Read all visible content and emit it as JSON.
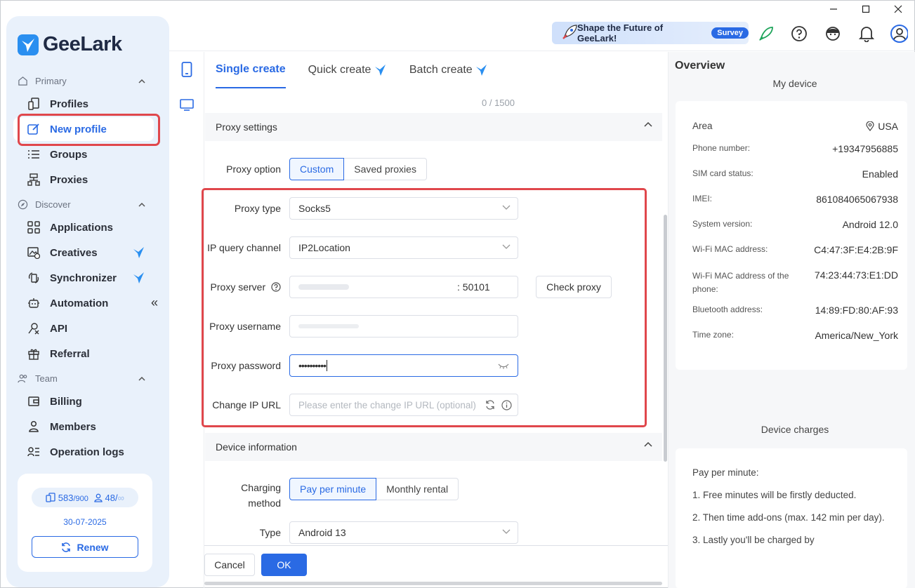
{
  "app": {
    "name": "GeeLark"
  },
  "sidebar": {
    "sections": [
      {
        "label": "Primary",
        "items": [
          "Profiles",
          "New profile",
          "Groups",
          "Proxies"
        ]
      },
      {
        "label": "Discover",
        "items": [
          "Applications",
          "Creatives",
          "Synchronizer",
          "Automation",
          "API",
          "Referral"
        ]
      },
      {
        "label": "Team",
        "items": [
          "Billing",
          "Members",
          "Operation logs"
        ]
      }
    ],
    "active_item": "New profile",
    "quota": {
      "devices": "583",
      "devices_max": "/900",
      "members": "48/",
      "members_max": "∞"
    },
    "expiry_date": "30-07-2025",
    "renew_label": "Renew"
  },
  "topbar": {
    "banner_text": "Shape the Future of GeeLark!",
    "survey_label": "Survey"
  },
  "tabs": [
    {
      "label": "Single create",
      "active": true
    },
    {
      "label": "Quick create",
      "active": false
    },
    {
      "label": "Batch create",
      "active": false
    }
  ],
  "counter": "0 / 1500",
  "proxy_settings": {
    "title": "Proxy settings",
    "option_label": "Proxy option",
    "options": [
      "Custom",
      "Saved proxies"
    ],
    "selected_option": "Custom",
    "type_label": "Proxy type",
    "type_value": "Socks5",
    "channel_label": "IP query channel",
    "channel_value": "IP2Location",
    "server_label": "Proxy server",
    "server_port": ": 50101",
    "check_label": "Check proxy",
    "username_label": "Proxy username",
    "password_label": "Proxy password",
    "password_value": "••••••••••",
    "change_ip_label": "Change IP URL",
    "change_ip_placeholder": "Please enter the change IP URL (optional)"
  },
  "device_info": {
    "title": "Device information",
    "charging_label_1": "Charging",
    "charging_label_2": "method",
    "charging_options": [
      "Pay per minute",
      "Monthly rental"
    ],
    "selected_charging": "Pay per minute",
    "type_label": "Type",
    "type_value": "Android 13"
  },
  "footer": {
    "cancel": "Cancel",
    "ok": "OK"
  },
  "overview": {
    "title": "Overview",
    "subtitle": "My device",
    "rows": [
      {
        "k": "Area",
        "v": "USA"
      },
      {
        "k": "Phone number:",
        "v": "+19347956885"
      },
      {
        "k": "SIM card status:",
        "v": "Enabled"
      },
      {
        "k": "IMEI:",
        "v": "861084065067938"
      },
      {
        "k": "System version:",
        "v": "Android 12.0"
      },
      {
        "k": "Wi-Fi MAC address:",
        "v": "C4:47:3F:E4:2B:9F"
      },
      {
        "k": "Wi-Fi MAC address of the phone:",
        "v": "74:23:44:73:E1:DD"
      },
      {
        "k": "Bluetooth address:",
        "v": "14:89:FD:80:AF:93"
      },
      {
        "k": "Time zone:",
        "v": "America/New_York"
      }
    ],
    "charges_title": "Device charges",
    "charges": [
      "Pay per minute:",
      "1. Free minutes will be firstly deducted.",
      "2. Then time add-ons (max. 142 min per day).",
      "3. Lastly you'll be charged by"
    ]
  },
  "colors": {
    "accent": "#2a6ae4",
    "highlight": "#e0474c",
    "sidebar_bg": "#e9f1fb"
  }
}
